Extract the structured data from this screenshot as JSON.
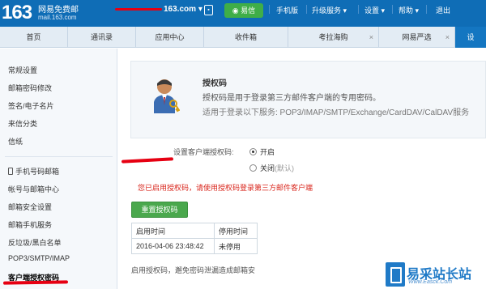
{
  "topbar": {
    "logo_number": "163",
    "logo_name": "网易免费邮",
    "logo_domain": "mail.163.com",
    "account_visible": "163.com",
    "account_dropdown": "▾",
    "yixin_label": "易信",
    "links": [
      "手机版",
      "升级服务 ▾",
      "设置 ▾",
      "帮助 ▾",
      "退出"
    ]
  },
  "tabs": [
    {
      "label": "首页",
      "active": false,
      "closable": false
    },
    {
      "label": "通讯录",
      "active": false,
      "closable": false
    },
    {
      "label": "应用中心",
      "active": false,
      "closable": false
    },
    {
      "label": "收件箱",
      "active": false,
      "closable": false
    },
    {
      "label": "考拉海购",
      "active": false,
      "closable": true
    },
    {
      "label": "网易严选",
      "active": false,
      "closable": true
    },
    {
      "label": "设",
      "active": true,
      "closable": false
    }
  ],
  "tab_close_glyph": "×",
  "sidebar": {
    "items": [
      "常规设置",
      "邮箱密码修改",
      "签名/电子名片",
      "来信分类",
      "信纸",
      "手机号码邮箱",
      "帐号与邮箱中心",
      "邮箱安全设置",
      "邮箱手机服务",
      "反垃圾/黑白名单",
      "POP3/SMTP/IMAP",
      "客户端授权密码"
    ],
    "active_item": "客户端授权密码"
  },
  "info": {
    "title": "授权码",
    "description": "授权码是用于登录第三方邮件客户端的专用密码。",
    "services": "适用于登录以下服务: POP3/IMAP/SMTP/Exchange/CardDAV/CalDAV服务"
  },
  "setting": {
    "label": "设置客户端授权码:",
    "option_on": "开启",
    "option_off": "关闭",
    "option_off_note": "(默认)",
    "selected": "开启"
  },
  "notice": "您已启用授权码，请使用授权码登录第三方邮件客户端",
  "reset_button": "重置授权码",
  "table": {
    "headers": [
      "启用时间",
      "停用时间"
    ],
    "rows": [
      [
        "2016-04-06 23:48:42",
        "未停用"
      ]
    ]
  },
  "footer_note": "启用授权码，邂免密码泄漏造成邮箱安",
  "watermark": {
    "cn": "易采站长站",
    "en": "Www.Easck.Com"
  },
  "colors": {
    "topbar": "#0f6db6",
    "active_tab": "#1476c1",
    "green_button": "#4aa84d",
    "notice_red": "#d9261c",
    "annotation_red": "#e60012"
  }
}
